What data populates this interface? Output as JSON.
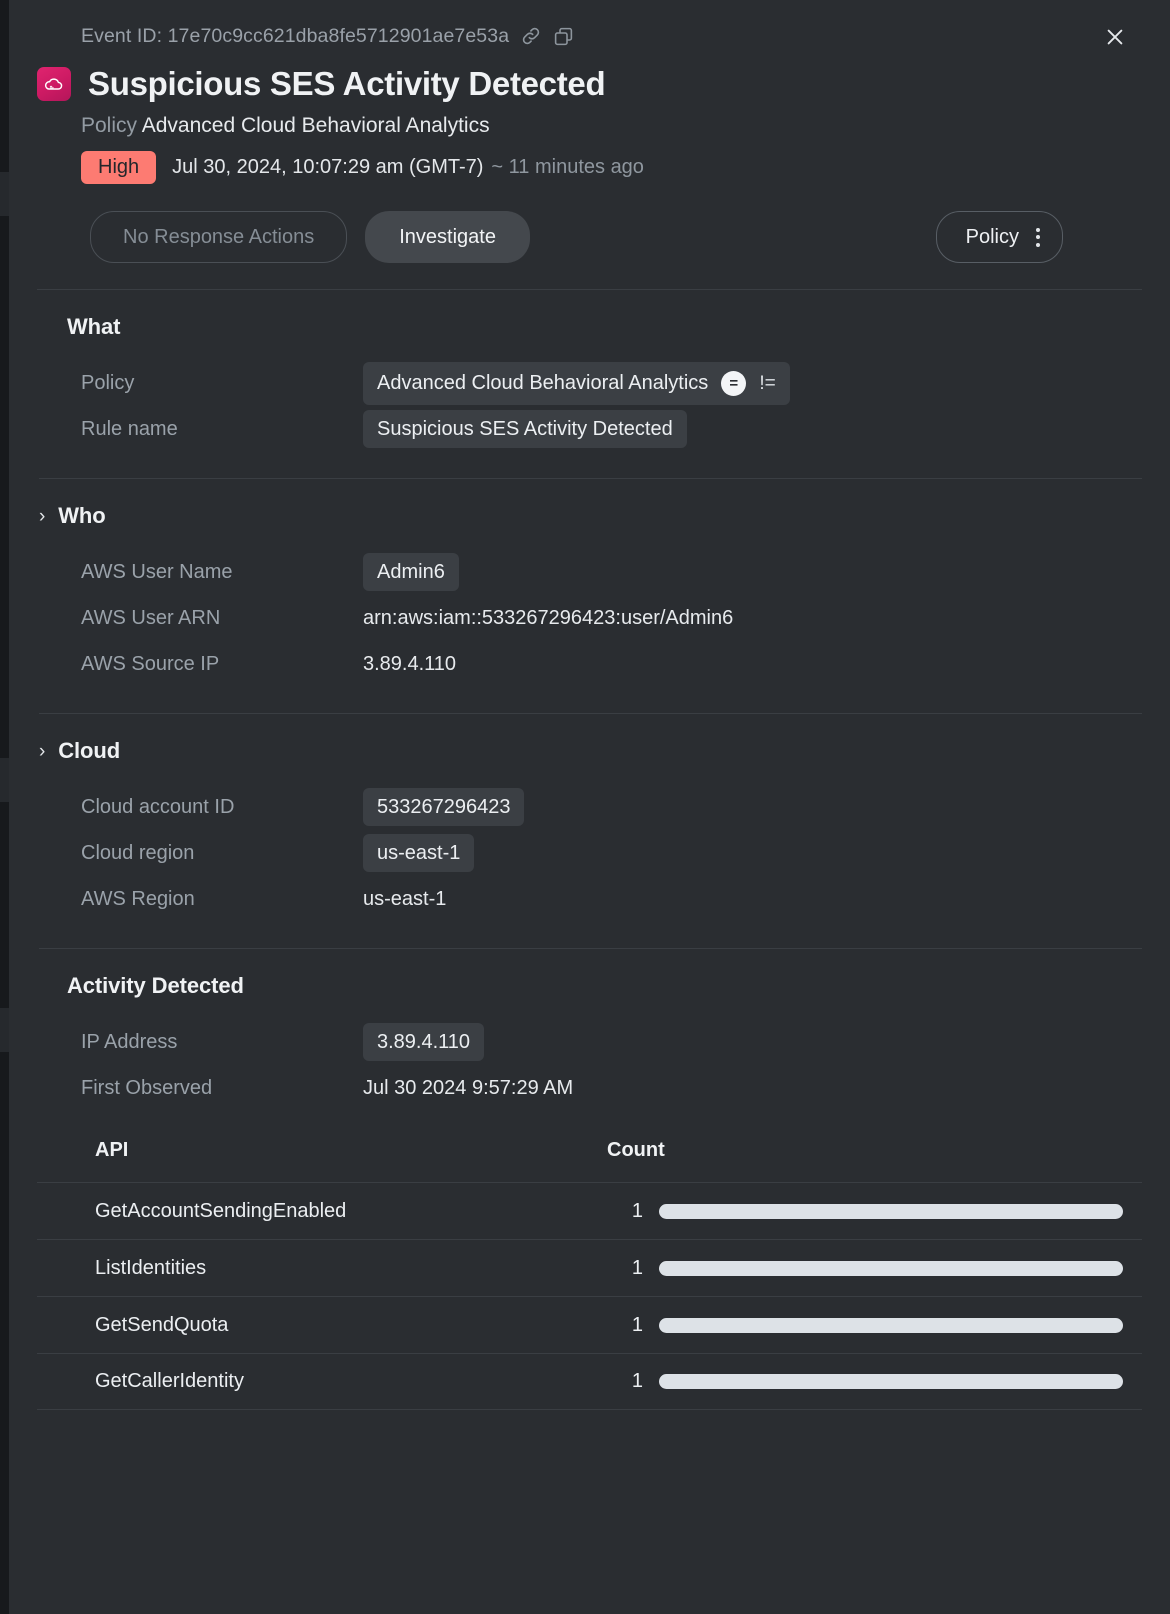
{
  "header": {
    "event_id_label": "Event ID:",
    "event_id": "17e70c9cc621dba8fe5712901ae7e53a",
    "event_id_full": "Event ID: 17e70c9cc621dba8fe5712901ae7e53a",
    "link_icon": "link-icon",
    "copy_icon": "copy-icon",
    "close_icon": "close-icon",
    "app_icon": "cloud-icon",
    "title": "Suspicious SES Activity Detected",
    "policy_label": "Policy",
    "policy_name": "Advanced Cloud Behavioral Analytics",
    "severity": "High",
    "severity_color": "#fd7b72",
    "timestamp": "Jul 30, 2024, 10:07:29 am (GMT-7)",
    "relative_time": "~ 11 minutes ago"
  },
  "actions": {
    "no_response_actions": "No Response Actions",
    "investigate": "Investigate",
    "policy": "Policy",
    "kebab_icon": "more-vertical-icon"
  },
  "sections": {
    "what": {
      "title": "What",
      "collapsible": false,
      "fields": [
        {
          "label": "Policy",
          "value": "Advanced Cloud Behavioral Analytics",
          "chip": true,
          "operators": {
            "eq": "=",
            "neq": "!="
          }
        },
        {
          "label": "Rule name",
          "value": "Suspicious SES Activity Detected",
          "chip": true
        }
      ]
    },
    "who": {
      "title": "Who",
      "collapsible": true,
      "chevron": "›",
      "fields": [
        {
          "label": "AWS User Name",
          "value": "Admin6",
          "chip": true
        },
        {
          "label": "AWS User ARN",
          "value": "arn:aws:iam::533267296423:user/Admin6",
          "chip": false
        },
        {
          "label": "AWS Source IP",
          "value": "3.89.4.110",
          "chip": false
        }
      ]
    },
    "cloud": {
      "title": "Cloud",
      "collapsible": true,
      "chevron": "›",
      "fields": [
        {
          "label": "Cloud account ID",
          "value": "533267296423",
          "chip": true
        },
        {
          "label": "Cloud region",
          "value": "us-east-1",
          "chip": true
        },
        {
          "label": "AWS Region",
          "value": "us-east-1",
          "chip": false
        }
      ]
    },
    "activity": {
      "title": "Activity Detected",
      "collapsible": false,
      "fields": [
        {
          "label": "IP Address",
          "value": "3.89.4.110",
          "chip": true
        },
        {
          "label": "First Observed",
          "value": "Jul 30 2024 9:57:29 AM",
          "chip": false
        }
      ],
      "table": {
        "columns": [
          "API",
          "Count"
        ],
        "rows": [
          {
            "api": "GetAccountSendingEnabled",
            "count": "1",
            "bar_pct": 100
          },
          {
            "api": "ListIdentities",
            "count": "1",
            "bar_pct": 100
          },
          {
            "api": "GetSendQuota",
            "count": "1",
            "bar_pct": 100
          },
          {
            "api": "GetCallerIdentity",
            "count": "1",
            "bar_pct": 100
          }
        ]
      }
    }
  }
}
